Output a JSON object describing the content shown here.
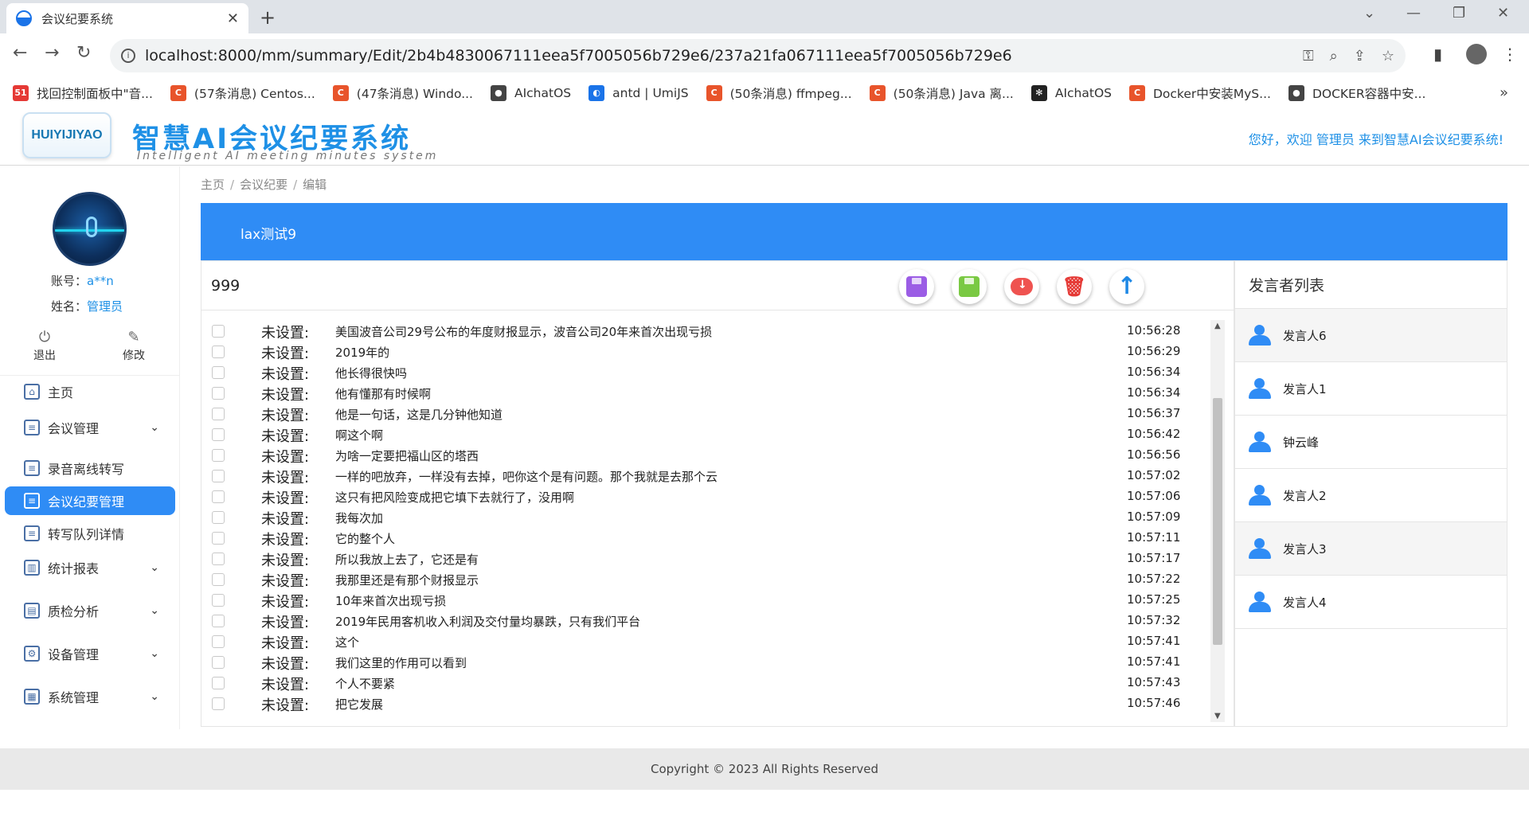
{
  "browser": {
    "tab_title": "会议纪要系统",
    "url": "localhost:8000/mm/summary/Edit/2b4b4830067111eea5f7005056b729e6/237a21fa067111eea5f7005056b729e6",
    "bookmarks": [
      {
        "label": "找回控制面板中\"音...",
        "icon": "51",
        "color": "#e53935"
      },
      {
        "label": "(57条消息) Centos...",
        "icon": "C",
        "color": "#e8542b"
      },
      {
        "label": "(47条消息) Windo...",
        "icon": "C",
        "color": "#e8542b"
      },
      {
        "label": "AIchatOS",
        "icon": "●",
        "color": "#444444"
      },
      {
        "label": "antd | UmiJS",
        "icon": "◐",
        "color": "#1a73e8"
      },
      {
        "label": "(50条消息) ffmpeg...",
        "icon": "C",
        "color": "#e8542b"
      },
      {
        "label": "(50条消息) Java 离...",
        "icon": "C",
        "color": "#e8542b"
      },
      {
        "label": "AIchatOS",
        "icon": "✻",
        "color": "#222222"
      },
      {
        "label": "Docker中安装MyS...",
        "icon": "C",
        "color": "#e8542b"
      },
      {
        "label": "DOCKER容器中安...",
        "icon": "●",
        "color": "#444444"
      }
    ]
  },
  "header": {
    "logo_text": "HUIYIJIYAO",
    "title": "智慧AI会议纪要系统",
    "subtitle": "Intelligent AI meeting minutes system",
    "welcome": "您好，欢迎 管理员 来到智慧AI会议纪要系统!"
  },
  "sidebar": {
    "account_label": "账号：",
    "account_value": "a**n",
    "name_label": "姓名：",
    "name_value": "管理员",
    "logout_label": "退出",
    "edit_label": "修改",
    "menu": [
      {
        "label": "主页",
        "icon": "⌂",
        "has_caret": false
      },
      {
        "label": "会议管理",
        "icon": "≡",
        "has_caret": true
      },
      {
        "label": "录音离线转写",
        "icon": "≡",
        "has_caret": false
      },
      {
        "label": "会议纪要管理",
        "icon": "≡",
        "has_caret": false
      },
      {
        "label": "转写队列详情",
        "icon": "≡",
        "has_caret": false
      },
      {
        "label": "统计报表",
        "icon": "▥",
        "has_caret": true
      },
      {
        "label": "质检分析",
        "icon": "▤",
        "has_caret": true
      },
      {
        "label": "设备管理",
        "icon": "⚙",
        "has_caret": true
      },
      {
        "label": "系统管理",
        "icon": "▦",
        "has_caret": true
      }
    ]
  },
  "breadcrumb": [
    "主页",
    "会议纪要",
    "编辑"
  ],
  "banner_title": "lax测试9",
  "doc": {
    "title": "999",
    "rows": [
      {
        "speaker": "未设置:",
        "text": "美国波音公司29号公布的年度财报显示，波音公司20年来首次出现亏损",
        "time": "10:56:28"
      },
      {
        "speaker": "未设置:",
        "text": "2019年的",
        "time": "10:56:29"
      },
      {
        "speaker": "未设置:",
        "text": "他长得很快吗",
        "time": "10:56:34"
      },
      {
        "speaker": "未设置:",
        "text": "他有懂那有时候啊",
        "time": "10:56:34"
      },
      {
        "speaker": "未设置:",
        "text": "他是一句话，这是几分钟他知道",
        "time": "10:56:37"
      },
      {
        "speaker": "未设置:",
        "text": "啊这个啊",
        "time": "10:56:42"
      },
      {
        "speaker": "未设置:",
        "text": "为啥一定要把福山区的塔西",
        "time": "10:56:56"
      },
      {
        "speaker": "未设置:",
        "text": "一样的吧放弃，一样没有去掉，吧你这个是有问题。那个我就是去那个云",
        "time": "10:57:02"
      },
      {
        "speaker": "未设置:",
        "text": "这只有把风险变成把它填下去就行了，没用啊",
        "time": "10:57:06"
      },
      {
        "speaker": "未设置:",
        "text": "我每次加",
        "time": "10:57:09"
      },
      {
        "speaker": "未设置:",
        "text": "它的整个人",
        "time": "10:57:11"
      },
      {
        "speaker": "未设置:",
        "text": "所以我放上去了，它还是有",
        "time": "10:57:17"
      },
      {
        "speaker": "未设置:",
        "text": "我那里还是有那个财报显示",
        "time": "10:57:22"
      },
      {
        "speaker": "未设置:",
        "text": "10年来首次出现亏损",
        "time": "10:57:25"
      },
      {
        "speaker": "未设置:",
        "text": "2019年民用客机收入利润及交付量均暴跌，只有我们平台",
        "time": "10:57:32"
      },
      {
        "speaker": "未设置:",
        "text": "这个",
        "time": "10:57:41"
      },
      {
        "speaker": "未设置:",
        "text": "我们这里的作用可以看到",
        "time": "10:57:41"
      },
      {
        "speaker": "未设置:",
        "text": "个人不要紧",
        "time": "10:57:43"
      },
      {
        "speaker": "未设置:",
        "text": "把它发展",
        "time": "10:57:46"
      }
    ]
  },
  "speakers": {
    "title": "发言者列表",
    "items": [
      "发言人6",
      "发言人1",
      "钟云峰",
      "发言人2",
      "发言人3",
      "发言人4"
    ]
  },
  "footer": "Copyright © 2023 All Rights Reserved",
  "colors": {
    "primary": "#2f8cf5",
    "brand_text": "#1e90e6"
  }
}
